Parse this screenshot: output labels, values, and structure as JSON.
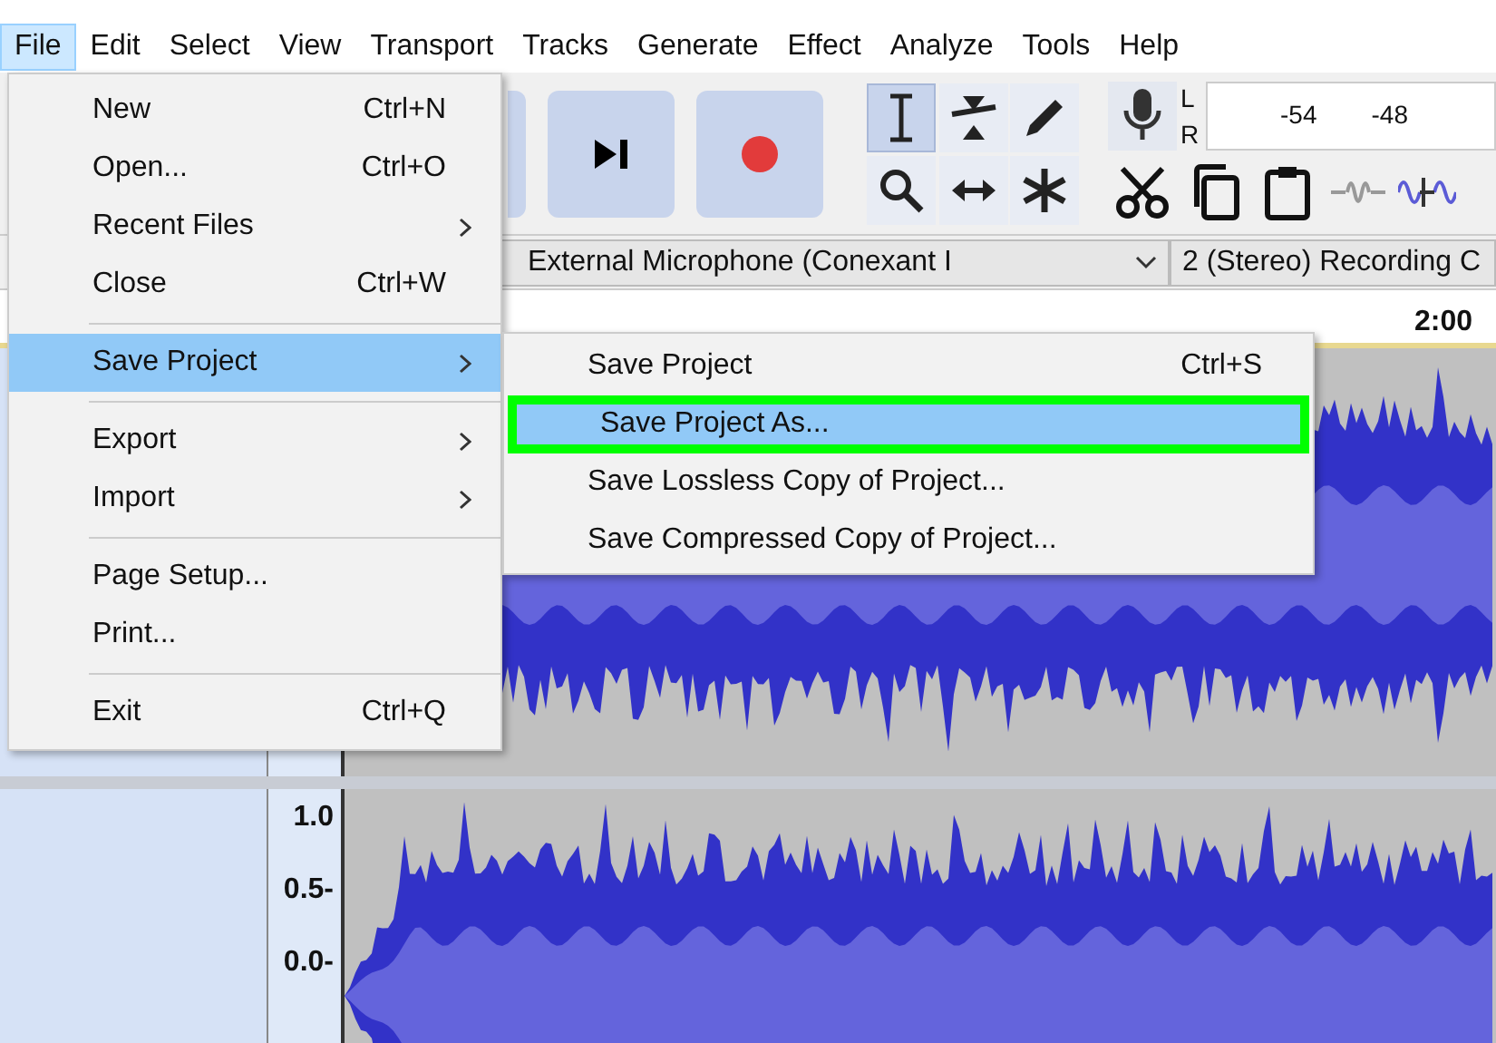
{
  "menu_bar": [
    {
      "label": "File",
      "selected": true
    },
    {
      "label": "Edit",
      "selected": false
    },
    {
      "label": "Select",
      "selected": false
    },
    {
      "label": "View",
      "selected": false
    },
    {
      "label": "Transport",
      "selected": false
    },
    {
      "label": "Tracks",
      "selected": false
    },
    {
      "label": "Generate",
      "selected": false
    },
    {
      "label": "Effect",
      "selected": false
    },
    {
      "label": "Analyze",
      "selected": false
    },
    {
      "label": "Tools",
      "selected": false
    },
    {
      "label": "Help",
      "selected": false
    }
  ],
  "tools": [
    {
      "kind": "selection",
      "selected": true
    },
    {
      "kind": "envelope",
      "selected": false
    },
    {
      "kind": "draw",
      "selected": false
    },
    {
      "kind": "zoom",
      "selected": false
    },
    {
      "kind": "timeshift",
      "selected": false
    },
    {
      "kind": "multi",
      "selected": false
    }
  ],
  "meter": {
    "channels": [
      "L",
      "R"
    ],
    "scale": [
      "-54",
      "-48"
    ]
  },
  "device_bar": {
    "input_device": "External Microphone (Conexant I",
    "channels": "2 (Stereo) Recording C"
  },
  "timeline": {
    "labels": [
      "2:00"
    ]
  },
  "tracks": [
    {
      "kind": "audio"
    },
    {
      "kind": "audio",
      "ruler": [
        "1.0",
        "0.5-",
        "0.0-"
      ]
    }
  ],
  "file_menu": {
    "items": [
      {
        "kind": "item",
        "label": "New",
        "shortcut": "Ctrl+N"
      },
      {
        "kind": "item",
        "label": "Open...",
        "shortcut": "Ctrl+O"
      },
      {
        "kind": "submenu",
        "label": "Recent Files",
        "selected": false
      },
      {
        "kind": "item",
        "label": "Close",
        "shortcut": "Ctrl+W"
      },
      {
        "kind": "separator"
      },
      {
        "kind": "submenu",
        "label": "Save Project",
        "selected": true
      },
      {
        "kind": "separator"
      },
      {
        "kind": "submenu",
        "label": "Export",
        "selected": false
      },
      {
        "kind": "submenu",
        "label": "Import",
        "selected": false
      },
      {
        "kind": "separator"
      },
      {
        "kind": "item",
        "label": "Page Setup..."
      },
      {
        "kind": "item",
        "label": "Print..."
      },
      {
        "kind": "separator"
      },
      {
        "kind": "item",
        "label": "Exit",
        "shortcut": "Ctrl+Q"
      }
    ]
  },
  "save_submenu": {
    "items": [
      {
        "label": "Save Project",
        "shortcut": "Ctrl+S",
        "selected": false,
        "outlined": false
      },
      {
        "label": "Save Project As...",
        "selected": true,
        "outlined": true
      },
      {
        "label": "Save Lossless Copy of Project...",
        "selected": false,
        "outlined": false
      },
      {
        "label": "Save Compressed Copy of Project...",
        "selected": false,
        "outlined": false
      }
    ]
  }
}
